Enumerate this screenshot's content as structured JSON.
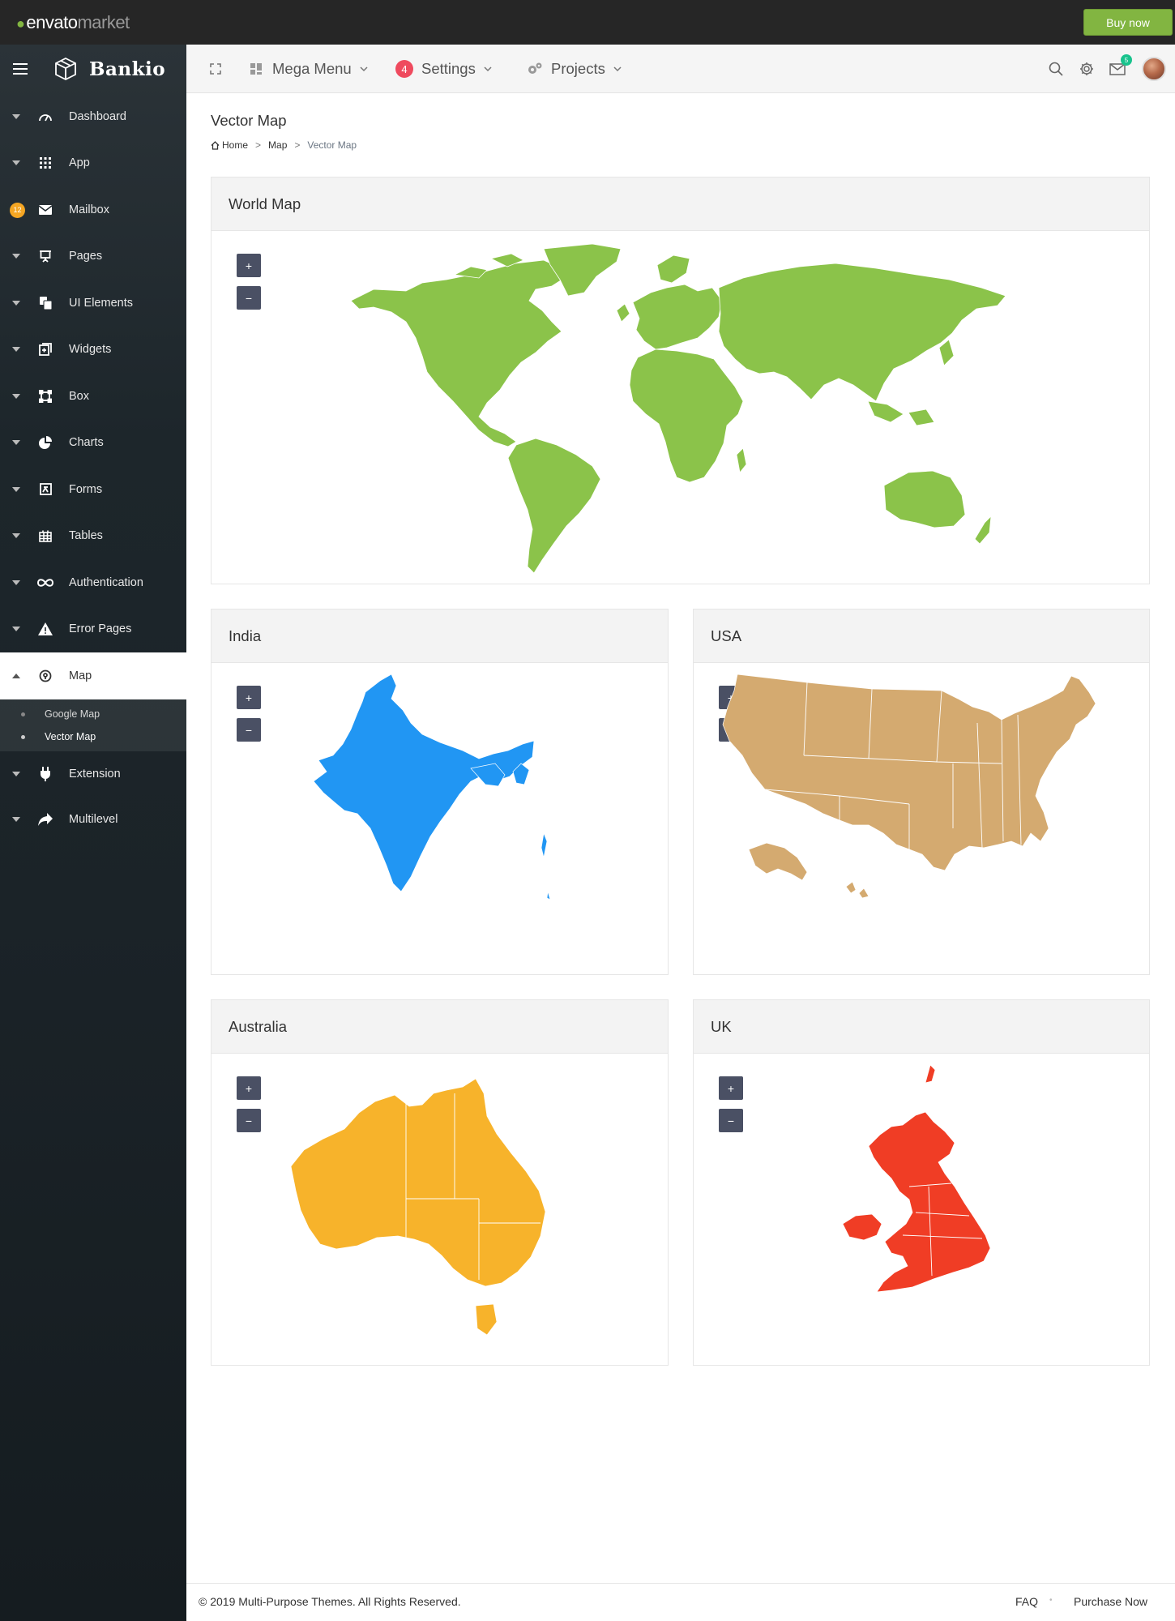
{
  "envato": {
    "logo_word": "envato",
    "logo_suffix": "market",
    "buy_label": "Buy now"
  },
  "sidebar": {
    "brand": "Bankio",
    "items": [
      {
        "label": "Dashboard",
        "icon": "dashboard-icon"
      },
      {
        "label": "App",
        "icon": "grid-icon"
      },
      {
        "label": "Mailbox",
        "icon": "envelope-icon",
        "badge": "12"
      },
      {
        "label": "Pages",
        "icon": "presentation-icon"
      },
      {
        "label": "UI Elements",
        "icon": "copy-icon"
      },
      {
        "label": "Widgets",
        "icon": "widgets-icon"
      },
      {
        "label": "Box",
        "icon": "box-icon"
      },
      {
        "label": "Charts",
        "icon": "pie-chart-icon"
      },
      {
        "label": "Forms",
        "icon": "form-icon"
      },
      {
        "label": "Tables",
        "icon": "table-icon"
      },
      {
        "label": "Authentication",
        "icon": "infinity-icon"
      },
      {
        "label": "Error Pages",
        "icon": "warning-icon"
      },
      {
        "label": "Map",
        "icon": "map-pin-icon",
        "active": true
      }
    ],
    "map_submenu": [
      {
        "label": "Google Map"
      },
      {
        "label": "Vector Map",
        "active": true
      }
    ],
    "bottom_items": [
      {
        "label": "Extension",
        "icon": "plug-icon"
      },
      {
        "label": "Multilevel",
        "icon": "share-icon"
      }
    ]
  },
  "header": {
    "mega_menu": "Mega Menu",
    "settings": "Settings",
    "settings_badge": "4",
    "projects": "Projects",
    "mail_badge": "5"
  },
  "page": {
    "title": "Vector Map",
    "breadcrumb": {
      "home": "Home",
      "section": "Map",
      "current": "Vector Map"
    }
  },
  "maps": {
    "zoom_in": "+",
    "zoom_out": "−",
    "world": {
      "title": "World Map",
      "color": "#8bc34a"
    },
    "india": {
      "title": "India",
      "color": "#2196f3"
    },
    "usa": {
      "title": "USA",
      "color": "#d4aa70"
    },
    "australia": {
      "title": "Australia",
      "color": "#f7b32b"
    },
    "uk": {
      "title": "UK",
      "color": "#f03d25"
    }
  },
  "footer": {
    "copyright": "© 2019 Multi-Purpose Themes. All Rights Reserved.",
    "faq": "FAQ",
    "purchase": "Purchase Now"
  }
}
